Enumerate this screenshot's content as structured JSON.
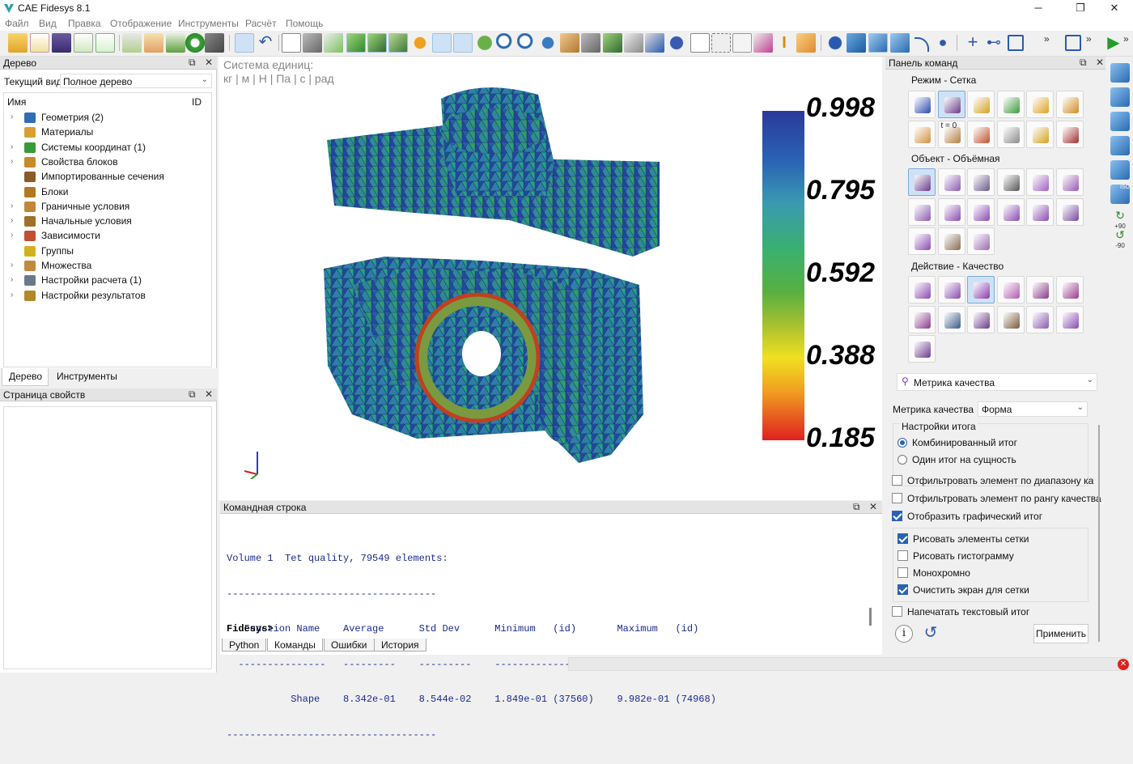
{
  "app": {
    "title": "CAE Fidesys 8.1",
    "win_minimize": "─",
    "win_restore": "❐",
    "win_close": "✕"
  },
  "menu": [
    "Файл",
    "Вид",
    "Правка",
    "Отображение",
    "Инструменты",
    "Расчёт",
    "Помощь"
  ],
  "tree_panel": {
    "title": "Дерево",
    "current_view_label": "Текущий вид",
    "current_view_value": "Полное дерево",
    "col_name": "Имя",
    "col_id": "ID",
    "items": [
      {
        "label": "Геометрия (2)",
        "expandable": true,
        "icon": "geometry-icon",
        "color": "#2f6db5"
      },
      {
        "label": "Материалы",
        "expandable": false,
        "icon": "materials-icon",
        "color": "#d8a032"
      },
      {
        "label": "Системы координат (1)",
        "expandable": true,
        "icon": "axes-icon",
        "color": "#3a9a3a"
      },
      {
        "label": "Свойства блоков",
        "expandable": true,
        "icon": "beam-icon",
        "color": "#c78b2a"
      },
      {
        "label": "Импортированные сечения",
        "expandable": false,
        "icon": "section-icon",
        "color": "#8a5a2a"
      },
      {
        "label": "Блоки",
        "expandable": false,
        "icon": "blocks-icon",
        "color": "#b07a22"
      },
      {
        "label": "Граничные условия",
        "expandable": true,
        "icon": "boundary-icon",
        "color": "#c0873a"
      },
      {
        "label": "Начальные условия",
        "expandable": true,
        "icon": "initial-icon",
        "color": "#a0702a"
      },
      {
        "label": "Зависимости",
        "expandable": true,
        "icon": "graph-icon",
        "color": "#c05030"
      },
      {
        "label": "Группы",
        "expandable": false,
        "icon": "groups-icon",
        "color": "#d4b020"
      },
      {
        "label": "Множества",
        "expandable": true,
        "icon": "sets-icon",
        "color": "#c08a40"
      },
      {
        "label": "Настройки расчета (1)",
        "expandable": true,
        "icon": "calc-settings-icon",
        "color": "#6a7a8a"
      },
      {
        "label": "Настройки результатов",
        "expandable": true,
        "icon": "results-icon",
        "color": "#b08a2a"
      }
    ],
    "tabs": [
      "Дерево",
      "Инструменты"
    ]
  },
  "props_panel": {
    "title": "Страница свойств"
  },
  "viewport": {
    "units_title": "Система единиц:",
    "units": "кг | м | Н | Па | с | рад",
    "legend": [
      "0.998",
      "0.795",
      "0.592",
      "0.388",
      "0.185"
    ]
  },
  "console": {
    "title": "Командная строка",
    "lines": [
      "Volume 1  Tet quality, 79549 elements:",
      "------------------------------------",
      "   Function Name    Average      Std Dev      Minimum   (id)       Maximum   (id)",
      "  ---------------   ---------    ---------    ----------------     ----------------",
      "           Shape    8.342e-01    8.544e-02    1.849e-01 (37560)    9.982e-01 (74968)",
      "------------------------------------"
    ],
    "prompt": "Fidesys>",
    "tabs": [
      "Python",
      "Команды",
      "Ошибки",
      "История"
    ]
  },
  "command_panel": {
    "title": "Панель команд",
    "section_mode": "Режим - Сетка",
    "section_object": "Объект - Объёмная",
    "section_action": "Действие - Качество",
    "tool_dropdown": "Метрика качества",
    "metric_label": "Метрика качества",
    "metric_value": "Форма",
    "summary_group": "Настройки итога",
    "radio_combined": "Комбинированный итог",
    "radio_per_entity": "Один итог на сущность",
    "chk_filter_range": "Отфильтровать элемент по диапазону качес",
    "chk_filter_rank": "Отфильтровать элемент по рангу качества",
    "chk_graphic": "Отобразить графический итог",
    "chk_draw_mesh": "Рисовать элементы сетки",
    "chk_histogram": "Рисовать гистограмму",
    "chk_mono": "Монохромно",
    "chk_clear": "Очистить экран для сетки",
    "chk_print": "Напечатать текстовый итог",
    "apply": "Применить",
    "rot_plus": "+90",
    "rot_minus": "-90",
    "iso": "ISO",
    "tfirst": "t = 0"
  }
}
